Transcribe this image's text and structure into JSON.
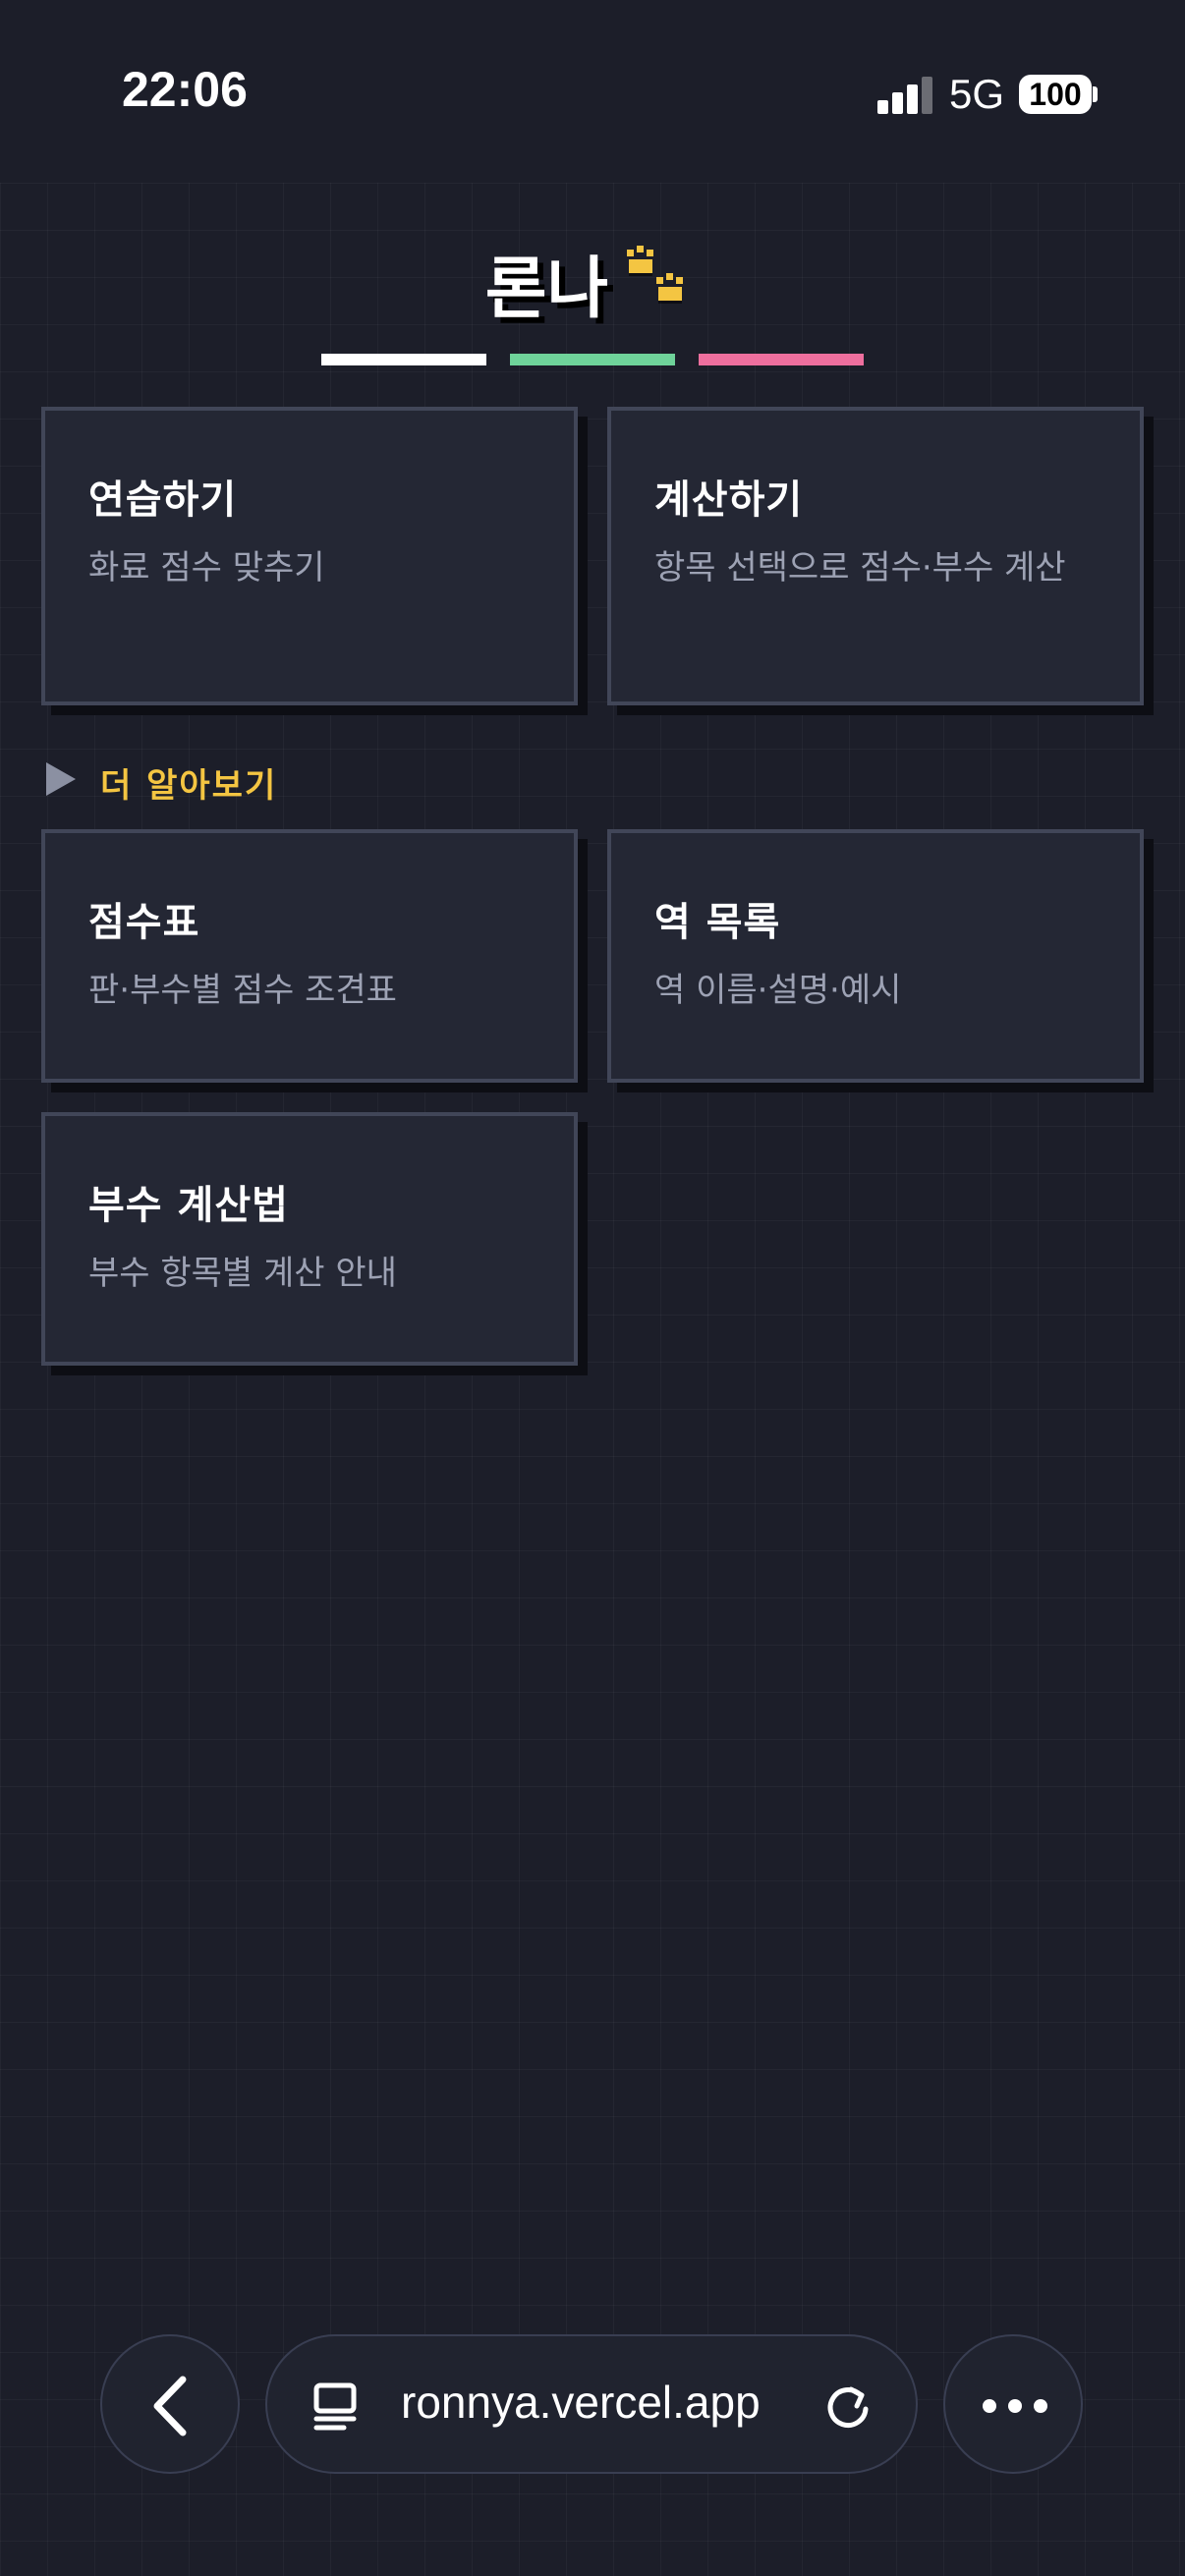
{
  "status_bar": {
    "time": "22:06",
    "network": "5G",
    "battery": "100"
  },
  "header": {
    "title": "론나",
    "title_icon": "paw-prints-icon",
    "accent_colors": [
      "#ffffff",
      "#6fd39a",
      "#ee6f9e"
    ]
  },
  "cards": [
    {
      "title": "연습하기",
      "desc": "화료 점수 맞추기"
    },
    {
      "title": "계산하기",
      "desc": "항목 선택으로 점수·부수 계산"
    }
  ],
  "more_section": {
    "label": "더 알아보기",
    "icon": "triangle-right-icon",
    "cards": [
      {
        "title": "점수표",
        "desc": "판·부수별 점수 조견표"
      },
      {
        "title": "역 목록",
        "desc": "역 이름·설명·예시"
      },
      {
        "title": "부수 계산법",
        "desc": "부수 항목별 계산 안내"
      }
    ]
  },
  "browser": {
    "url": "ronnya.vercel.app",
    "back_icon": "chevron-left-icon",
    "tabs_icon": "tabs-icon",
    "reload_icon": "reload-icon",
    "more_icon": "more-dots-icon"
  },
  "colors": {
    "background": "#1c1e29",
    "card": "#242734",
    "card_border": "#414658",
    "section_label": "#f4c542",
    "paw": "#f4c542"
  }
}
